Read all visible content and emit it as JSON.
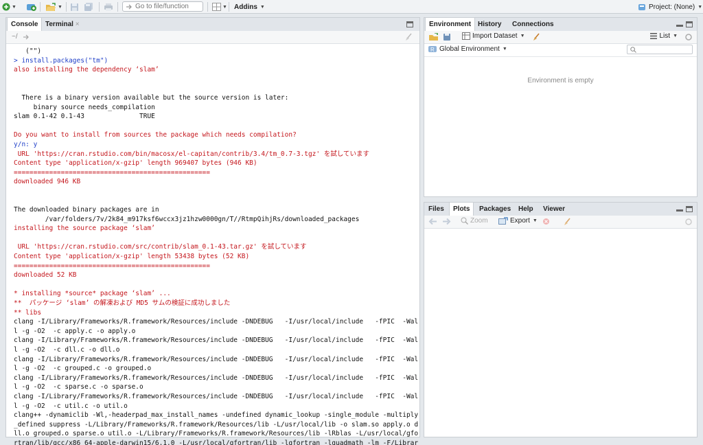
{
  "toolbar": {
    "goto_placeholder": "Go to file/function",
    "addins_label": "Addins",
    "project_label": "Project: (None)"
  },
  "console_pane": {
    "tabs": [
      "Console",
      "Terminal"
    ],
    "path": "~/",
    "lines": [
      {
        "text": "   (\"\")",
        "style": "blk"
      },
      {
        "text": "> install.packages(\"tm\")",
        "style": "blue"
      },
      {
        "text": "also installing the dependency ‘slam’",
        "style": "red"
      },
      {
        "text": "",
        "style": "blk"
      },
      {
        "text": "",
        "style": "blk"
      },
      {
        "text": "  There is a binary version available but the source version is later:",
        "style": "blk"
      },
      {
        "text": "     binary source needs_compilation",
        "style": "blk"
      },
      {
        "text": "slam 0.1-42 0.1-43              TRUE",
        "style": "blk"
      },
      {
        "text": "",
        "style": "blk"
      },
      {
        "text": "Do you want to install from sources the package which needs compilation?",
        "style": "red"
      },
      {
        "text": "y/n: y",
        "style": "blue"
      },
      {
        "text": " URL 'https://cran.rstudio.com/bin/macosx/el-capitan/contrib/3.4/tm_0.7-3.tgz' を試しています",
        "style": "red"
      },
      {
        "text": "Content type 'application/x-gzip' length 969407 bytes (946 KB)",
        "style": "red"
      },
      {
        "text": "==================================================",
        "style": "red"
      },
      {
        "text": "downloaded 946 KB",
        "style": "red"
      },
      {
        "text": "",
        "style": "blk"
      },
      {
        "text": "",
        "style": "blk"
      },
      {
        "text": "The downloaded binary packages are in",
        "style": "blk"
      },
      {
        "text": "        /var/folders/7v/2k84_m917ksf6wccx3jz1hzw0000gn/T//RtmpQihjRs/downloaded_packages",
        "style": "blk"
      },
      {
        "text": "installing the source package ‘slam’",
        "style": "red"
      },
      {
        "text": "",
        "style": "blk"
      },
      {
        "text": " URL 'https://cran.rstudio.com/src/contrib/slam_0.1-43.tar.gz' を試しています",
        "style": "red"
      },
      {
        "text": "Content type 'application/x-gzip' length 53438 bytes (52 KB)",
        "style": "red"
      },
      {
        "text": "==================================================",
        "style": "red"
      },
      {
        "text": "downloaded 52 KB",
        "style": "red"
      },
      {
        "text": "",
        "style": "blk"
      },
      {
        "text": "* installing *source* package ‘slam’ ...",
        "style": "red"
      },
      {
        "text": "**  パッケージ ‘slam’ の解凍および MD5 サムの検証に成功しました",
        "style": "red"
      },
      {
        "text": "** libs",
        "style": "red"
      },
      {
        "text": "clang -I/Library/Frameworks/R.framework/Resources/include -DNDEBUG   -I/usr/local/include   -fPIC  -Wal",
        "style": "blk"
      },
      {
        "text": "l -g -O2  -c apply.c -o apply.o",
        "style": "blk"
      },
      {
        "text": "clang -I/Library/Frameworks/R.framework/Resources/include -DNDEBUG   -I/usr/local/include   -fPIC  -Wal",
        "style": "blk"
      },
      {
        "text": "l -g -O2  -c dll.c -o dll.o",
        "style": "blk"
      },
      {
        "text": "clang -I/Library/Frameworks/R.framework/Resources/include -DNDEBUG   -I/usr/local/include   -fPIC  -Wal",
        "style": "blk"
      },
      {
        "text": "l -g -O2  -c grouped.c -o grouped.o",
        "style": "blk"
      },
      {
        "text": "clang -I/Library/Frameworks/R.framework/Resources/include -DNDEBUG   -I/usr/local/include   -fPIC  -Wal",
        "style": "blk"
      },
      {
        "text": "l -g -O2  -c sparse.c -o sparse.o",
        "style": "blk"
      },
      {
        "text": "clang -I/Library/Frameworks/R.framework/Resources/include -DNDEBUG   -I/usr/local/include   -fPIC  -Wal",
        "style": "blk"
      },
      {
        "text": "l -g -O2  -c util.c -o util.o",
        "style": "blk"
      },
      {
        "text": "clang++ -dynamiclib -Wl,-headerpad_max_install_names -undefined dynamic_lookup -single_module -multiply",
        "style": "blk"
      },
      {
        "text": "_defined suppress -L/Library/Frameworks/R.framework/Resources/lib -L/usr/local/lib -o slam.so apply.o d",
        "style": "blk"
      },
      {
        "text": "ll.o grouped.o sparse.o util.o -L/Library/Frameworks/R.framework/Resources/lib -lRblas -L/usr/local/gfo",
        "style": "blk"
      },
      {
        "text": "rtran/lib/gcc/x86_64-apple-darwin15/6.1.0 -L/usr/local/gfortran/lib -lgfortran -lquadmath -lm -F/Librar",
        "style": "blk"
      }
    ]
  },
  "env_pane": {
    "tabs": [
      "Environment",
      "History",
      "Connections"
    ],
    "import_label": "Import Dataset",
    "list_label": "List",
    "scope_label": "Global Environment",
    "empty_text": "Environment is empty"
  },
  "files_pane": {
    "tabs": [
      "Files",
      "Plots",
      "Packages",
      "Help",
      "Viewer"
    ],
    "zoom_label": "Zoom",
    "export_label": "Export"
  },
  "colors": {
    "console_red": "#c4161c",
    "console_blue": "#1f3fc8",
    "accent_green": "#3a9a3a"
  }
}
